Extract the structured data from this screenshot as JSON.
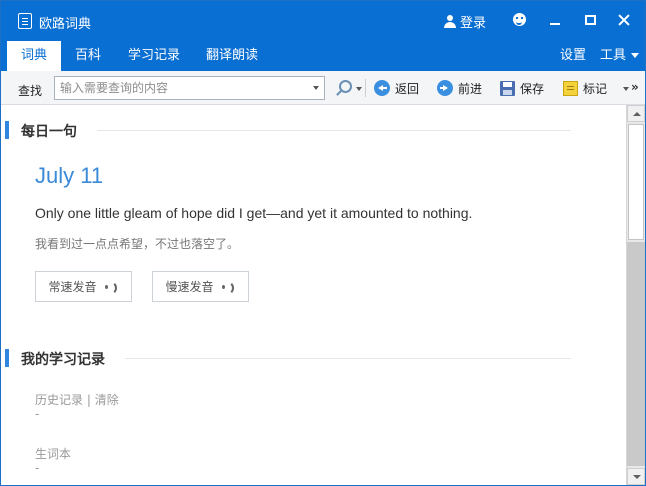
{
  "app": {
    "title": "欧路词典",
    "login_label": "登录"
  },
  "tabs": [
    {
      "label": "词典",
      "active": true
    },
    {
      "label": "百科",
      "active": false
    },
    {
      "label": "学习记录",
      "active": false
    },
    {
      "label": "翻译朗读",
      "active": false
    }
  ],
  "tab_right": {
    "settings_label": "设置",
    "tools_label": "工具"
  },
  "toolbar": {
    "find_label": "查找",
    "search_placeholder": "输入需要查询的内容",
    "search_value": "",
    "back_label": "返回",
    "forward_label": "前进",
    "save_label": "保存",
    "mark_label": "标记",
    "overflow_label": "»"
  },
  "daily": {
    "heading": "每日一句",
    "date": "July 11",
    "sentence_en": "Only one little gleam of hope did I get—and yet it amounted to nothing.",
    "sentence_zh": "我看到过一点点希望，不过也落空了。",
    "normal_speed_label": "常速发音",
    "slow_speed_label": "慢速发音"
  },
  "records": {
    "heading": "我的学习记录",
    "history_label": "历史记录",
    "separator": "|",
    "clear_label": "清除",
    "history_value": "-",
    "wordbook_label": "生词本",
    "wordbook_value": "-"
  },
  "colors": {
    "accent": "#0a6fd2",
    "date_blue": "#3a8ad8",
    "section_bar": "#2f86e0"
  }
}
